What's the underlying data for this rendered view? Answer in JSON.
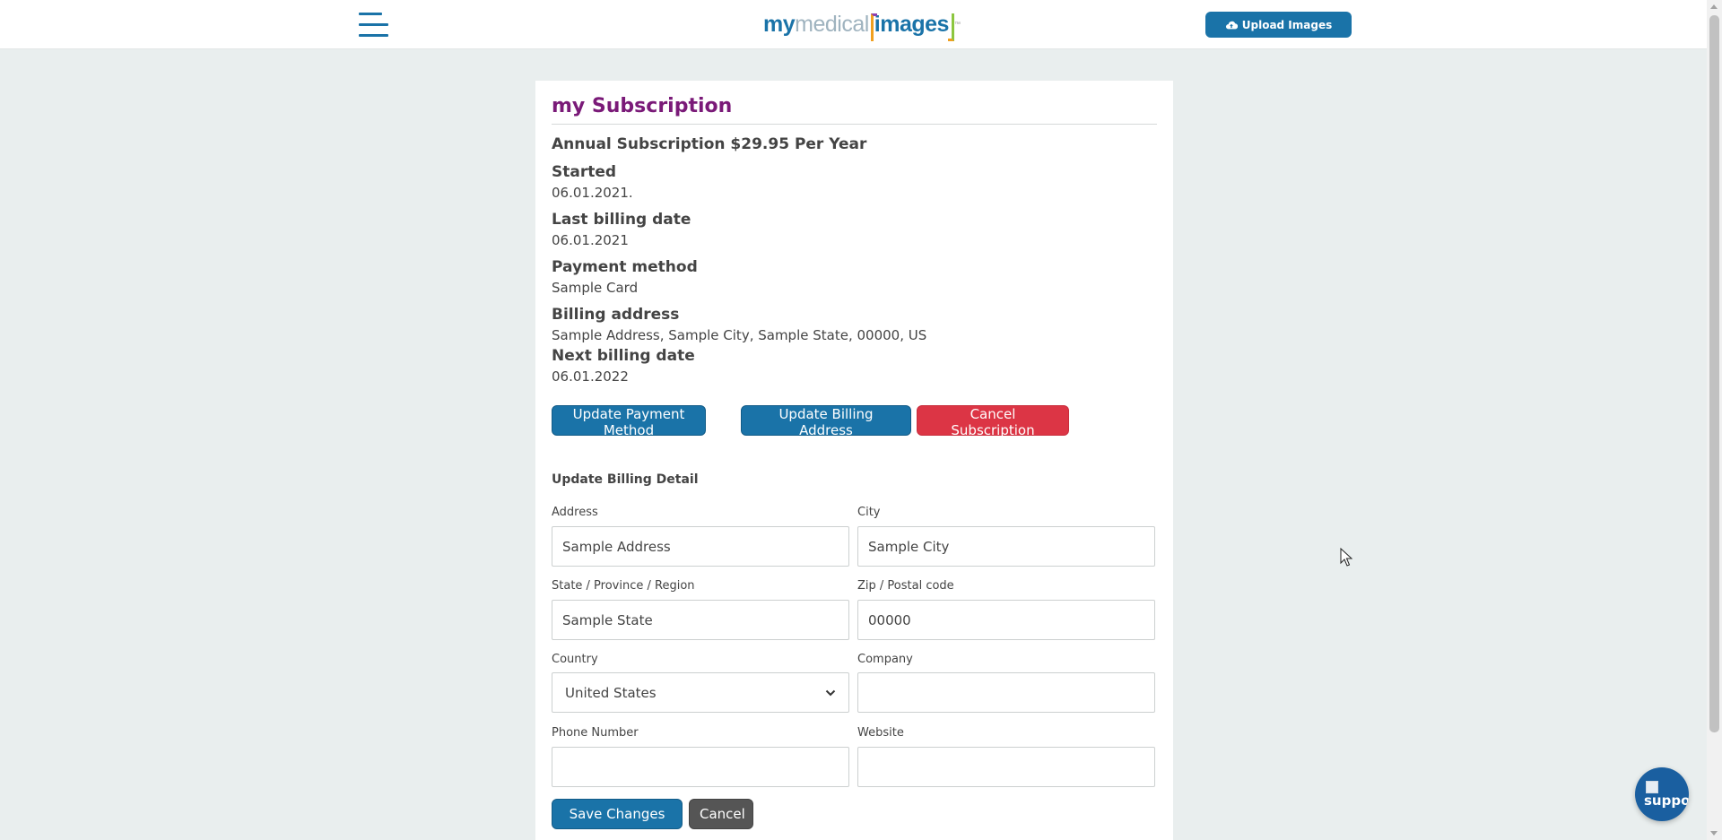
{
  "header": {
    "logo": {
      "my": "my",
      "medical": "medical",
      "images": "images",
      "tm": "™"
    },
    "upload_label": "Upload Images"
  },
  "card": {
    "title": "my Subscription",
    "plan": "Annual Subscription $29.95 Per Year",
    "fields": [
      {
        "label": "Started",
        "value": "06.01.2021."
      },
      {
        "label": "Last billing date",
        "value": "06.01.2021"
      },
      {
        "label": "Payment method",
        "value": "Sample Card"
      },
      {
        "label": "Billing address",
        "value": "Sample Address, Sample City, Sample State, 00000, US"
      },
      {
        "label": "Next billing date",
        "value": "06.01.2022"
      }
    ],
    "buttons": {
      "update_payment": "Update Payment Method",
      "update_billing": "Update Billing Address",
      "cancel_subscription": "Cancel Subscription"
    }
  },
  "billing_form": {
    "title": "Update Billing Detail",
    "address": {
      "label": "Address",
      "value": "Sample Address"
    },
    "city": {
      "label": "City",
      "value": "Sample City"
    },
    "state": {
      "label": "State / Province / Region",
      "value": "Sample State"
    },
    "zip": {
      "label": "Zip / Postal code",
      "value": "00000"
    },
    "country": {
      "label": "Country",
      "value": "United States"
    },
    "company": {
      "label": "Company",
      "value": ""
    },
    "phone": {
      "label": "Phone Number",
      "value": ""
    },
    "website": {
      "label": "Website",
      "value": ""
    },
    "save_label": "Save Changes",
    "cancel_label": "Cancel"
  },
  "support_widget": {
    "text": "supportc"
  },
  "colors": {
    "brand_blue": "#1a73a8",
    "title_purple": "#7a1a78",
    "danger_red": "#dc3545",
    "page_bg": "#e9eeee"
  },
  "icons": {
    "menu": "hamburger-menu-icon",
    "upload": "cloud-upload-icon",
    "dropdown": "chevron-down-icon"
  }
}
